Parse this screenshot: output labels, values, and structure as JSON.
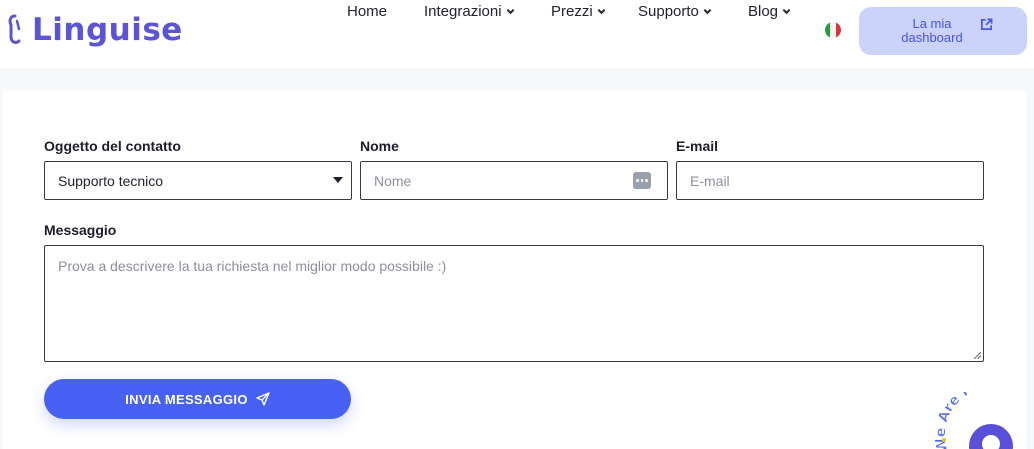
{
  "header": {
    "logo_text": "Linguise",
    "nav": [
      {
        "label": "Home",
        "has_dropdown": false
      },
      {
        "label": "Integrazioni",
        "has_dropdown": true
      },
      {
        "label": "Prezzi",
        "has_dropdown": true
      },
      {
        "label": "Supporto",
        "has_dropdown": true
      },
      {
        "label": "Blog",
        "has_dropdown": true
      }
    ],
    "language_flag": "italy-flag-icon",
    "dashboard_button": {
      "label_line1": "La mia",
      "label_line2": "dashboard",
      "icon": "external-link-icon"
    }
  },
  "form": {
    "subject": {
      "label": "Oggetto del contatto",
      "value": "Supporto tecnico"
    },
    "name": {
      "label": "Nome",
      "placeholder": "Nome"
    },
    "email": {
      "label": "E-mail",
      "placeholder": "E-mail"
    },
    "message": {
      "label": "Messaggio",
      "placeholder": "Prova a descrivere la tua richiesta nel miglior modo possibile :)"
    },
    "submit_label": "INVIA MESSAGGIO",
    "submit_icon": "paper-plane-icon"
  },
  "chat_widget": {
    "text": "We Are Here!"
  },
  "colors": {
    "brand": "#5b55d6",
    "button": "#4861f5",
    "dashboard_bg": "#ccd3fb",
    "widget": "#5a4fd8"
  }
}
